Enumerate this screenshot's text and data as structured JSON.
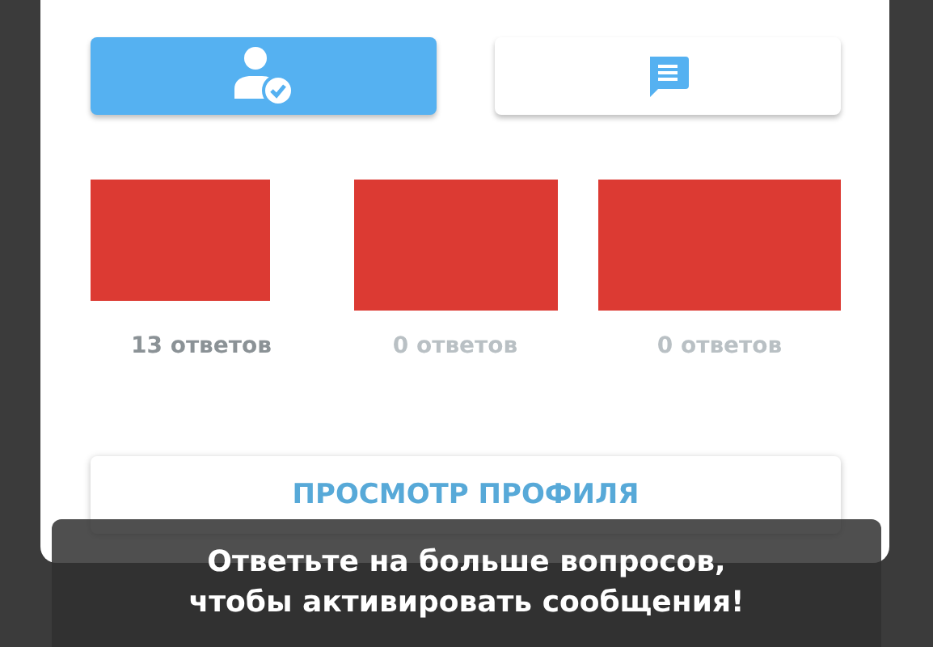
{
  "tabs": [
    {
      "kind": "profile",
      "selected": true
    },
    {
      "kind": "messages",
      "selected": false
    }
  ],
  "stats": [
    {
      "label": "13 ответов",
      "dimmed": false
    },
    {
      "label": "0 ответов",
      "dimmed": true
    },
    {
      "label": "0 ответов",
      "dimmed": true
    }
  ],
  "profile_button": {
    "label": "ПРОСМОТР ПРОФИЛЯ"
  },
  "toast": {
    "lines": [
      "Ответьте на больше вопросов,",
      "чтобы активировать сообщения!"
    ]
  }
}
